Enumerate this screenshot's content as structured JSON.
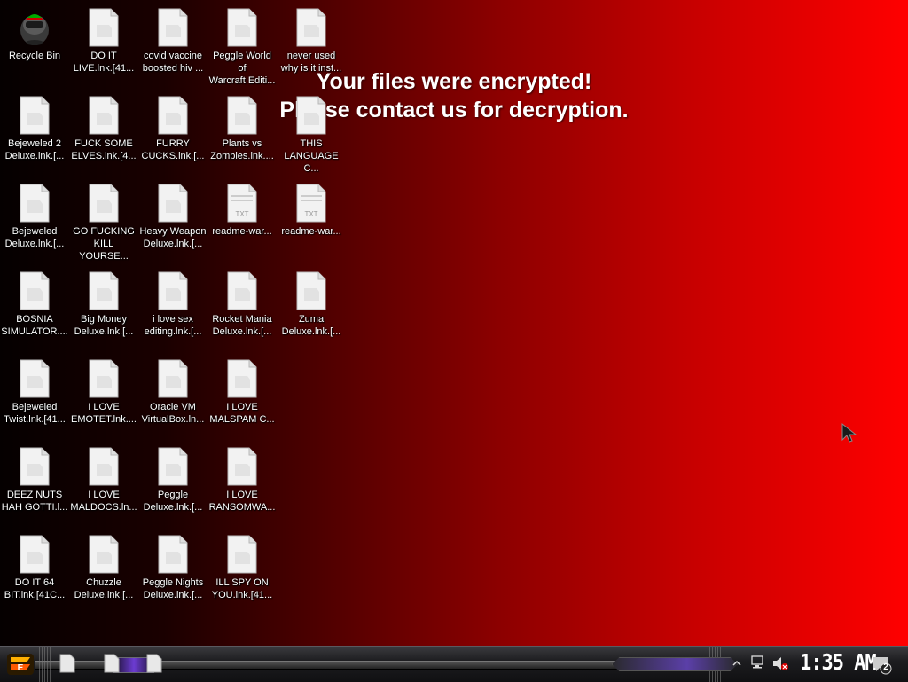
{
  "desktop": {
    "message": {
      "line1": "Your files were encrypted!",
      "line2": "Please contact us for decryption."
    },
    "icons": [
      {
        "label": "Recycle Bin",
        "type": "recycle"
      },
      {
        "label": "DO IT\nLIVE.lnk.[41...",
        "type": "file"
      },
      {
        "label": "covid vaccine\nboosted hiv ...",
        "type": "file"
      },
      {
        "label": "Peggle World of\nWarcraft Editi...",
        "type": "file"
      },
      {
        "label": "never used\nwhy is it inst...",
        "type": "file"
      },
      {
        "label": "Bejeweled 2\nDeluxe.lnk.[...",
        "type": "file"
      },
      {
        "label": "FUCK SOME\nELVES.lnk.[4...",
        "type": "file"
      },
      {
        "label": "FURRY\nCUCKS.lnk.[...",
        "type": "file"
      },
      {
        "label": "Plants vs\nZombies.lnk....",
        "type": "file"
      },
      {
        "label": "THIS\nLANGUAGE C...",
        "type": "file"
      },
      {
        "label": "Bejeweled\nDeluxe.lnk.[...",
        "type": "file"
      },
      {
        "label": "GO FUCKING\nKILL YOURSE...",
        "type": "file"
      },
      {
        "label": "Heavy Weapon\nDeluxe.lnk.[...",
        "type": "file"
      },
      {
        "label": "readme-war...",
        "type": "txt"
      },
      {
        "label": "readme-war...",
        "type": "txt"
      },
      {
        "label": "BOSNIA\nSIMULATOR....",
        "type": "file"
      },
      {
        "label": "Big Money\nDeluxe.lnk.[...",
        "type": "file"
      },
      {
        "label": "i love sex\nediting.lnk.[...",
        "type": "file"
      },
      {
        "label": "Rocket Mania\nDeluxe.lnk.[...",
        "type": "file"
      },
      {
        "label": "Zuma\nDeluxe.lnk.[...",
        "type": "file"
      },
      {
        "label": "Bejeweled\nTwist.lnk.[41...",
        "type": "file"
      },
      {
        "label": "I LOVE\nEMOTET.lnk....",
        "type": "file"
      },
      {
        "label": "Oracle VM\nVirtualBox.ln...",
        "type": "file"
      },
      {
        "label": "I LOVE\nMALSPAM C...",
        "type": "file"
      },
      {
        "label": "DEEZ NUTS\nHAH GOTTI.l...",
        "type": "file"
      },
      {
        "label": "I LOVE\nMALDOCS.ln...",
        "type": "file"
      },
      {
        "label": "Peggle\nDeluxe.lnk.[...",
        "type": "file"
      },
      {
        "label": "I LOVE\nRANSOMWA...",
        "type": "file"
      },
      {
        "label": "DO IT 64\nBIT.lnk.[41C...",
        "type": "file"
      },
      {
        "label": "Chuzzle\nDeluxe.lnk.[...",
        "type": "file"
      },
      {
        "label": "Peggle Nights\nDeluxe.lnk.[...",
        "type": "file"
      },
      {
        "label": "ILL SPY ON\nYOU.lnk.[41...",
        "type": "file"
      }
    ]
  },
  "taskbar": {
    "clock": "1:35 AM",
    "notification_count": "2",
    "start_icon": "start-orb-icon",
    "tray_icons": [
      "show-hidden-icons-chevron-icon",
      "network-icon",
      "volume-muted-icon"
    ]
  },
  "colors": {
    "background_left": "#050000",
    "background_right": "#ff0000",
    "taskbar_accent": "#6c3cd2"
  }
}
